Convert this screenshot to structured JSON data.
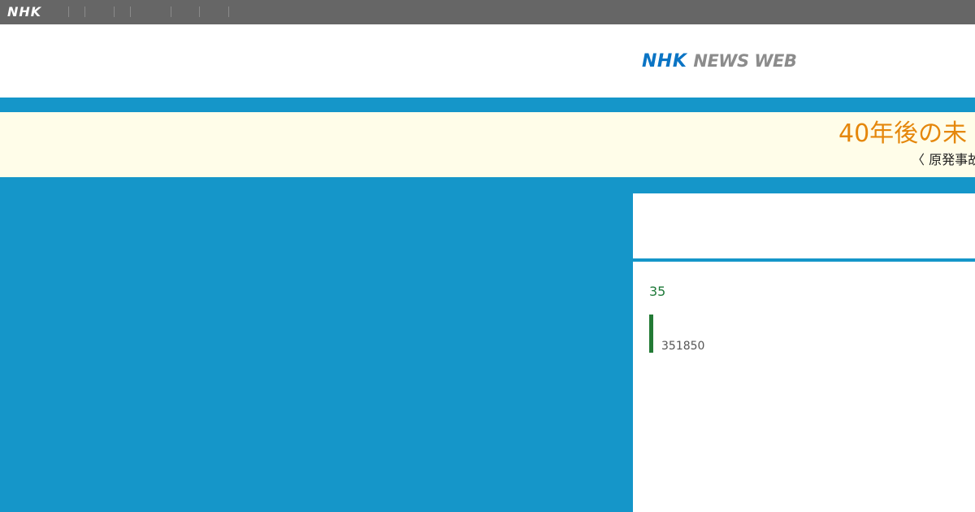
{
  "topbar": {
    "logo": "NHK",
    "separators": 6
  },
  "header": {
    "logo_nhk": "NHK",
    "logo_rest": "NEWS WEB"
  },
  "banner": {
    "title": "40年後の未",
    "subtitle": "〈 原発事故"
  },
  "panel": {
    "count": "35",
    "number": "351850"
  },
  "colors": {
    "accent_blue": "#1596c9",
    "banner_bg": "#fffde9",
    "banner_title": "#e5870c",
    "count_green": "#1f7a3a"
  }
}
